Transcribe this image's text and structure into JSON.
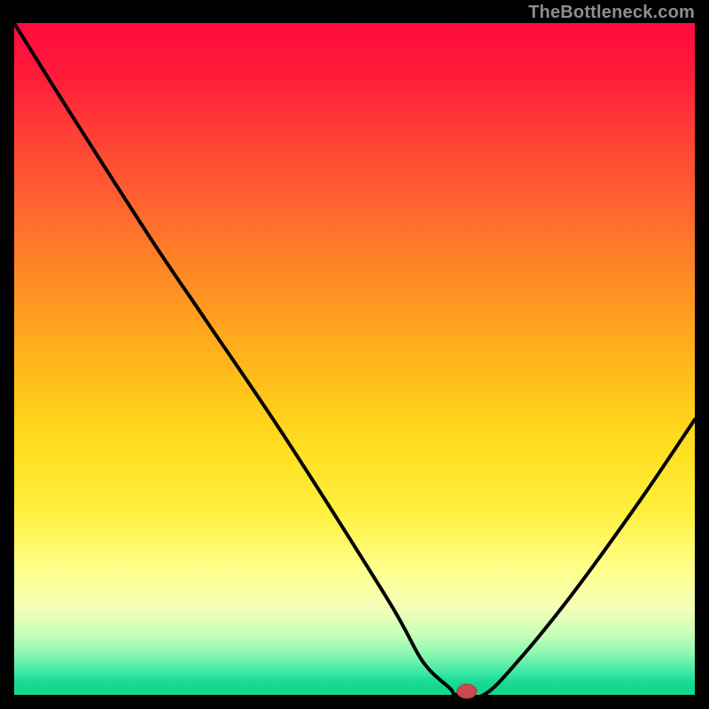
{
  "attribution": "TheBottleneck.com",
  "colors": {
    "background": "#000000",
    "attribution_text": "#8e8e8e",
    "curve": "#000000",
    "marker_fill": "#C94B4F",
    "marker_stroke": "#B6383D"
  },
  "chart_data": {
    "type": "line",
    "title": "",
    "xlabel": "",
    "ylabel": "",
    "xlim": [
      0,
      100
    ],
    "ylim": [
      0,
      100
    ],
    "x": [
      0,
      8,
      20,
      28,
      40,
      55,
      60,
      64,
      65,
      69,
      74,
      82,
      92,
      100
    ],
    "values": [
      100,
      87,
      68,
      56,
      38,
      14,
      5,
      1,
      0,
      0,
      5,
      15,
      29,
      41
    ],
    "marker": {
      "x": 66.5,
      "y": 0
    },
    "gradient_desc": "vertical red-to-green (top=red=bad, bottom=green=good)"
  }
}
